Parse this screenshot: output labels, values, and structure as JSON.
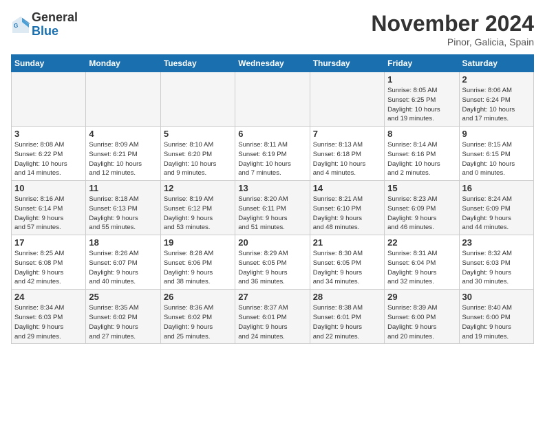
{
  "logo": {
    "line1": "General",
    "line2": "Blue"
  },
  "title": "November 2024",
  "location": "Pinor, Galicia, Spain",
  "days_of_week": [
    "Sunday",
    "Monday",
    "Tuesday",
    "Wednesday",
    "Thursday",
    "Friday",
    "Saturday"
  ],
  "weeks": [
    [
      {
        "day": "",
        "info": ""
      },
      {
        "day": "",
        "info": ""
      },
      {
        "day": "",
        "info": ""
      },
      {
        "day": "",
        "info": ""
      },
      {
        "day": "",
        "info": ""
      },
      {
        "day": "1",
        "info": "Sunrise: 8:05 AM\nSunset: 6:25 PM\nDaylight: 10 hours\nand 19 minutes."
      },
      {
        "day": "2",
        "info": "Sunrise: 8:06 AM\nSunset: 6:24 PM\nDaylight: 10 hours\nand 17 minutes."
      }
    ],
    [
      {
        "day": "3",
        "info": "Sunrise: 8:08 AM\nSunset: 6:22 PM\nDaylight: 10 hours\nand 14 minutes."
      },
      {
        "day": "4",
        "info": "Sunrise: 8:09 AM\nSunset: 6:21 PM\nDaylight: 10 hours\nand 12 minutes."
      },
      {
        "day": "5",
        "info": "Sunrise: 8:10 AM\nSunset: 6:20 PM\nDaylight: 10 hours\nand 9 minutes."
      },
      {
        "day": "6",
        "info": "Sunrise: 8:11 AM\nSunset: 6:19 PM\nDaylight: 10 hours\nand 7 minutes."
      },
      {
        "day": "7",
        "info": "Sunrise: 8:13 AM\nSunset: 6:18 PM\nDaylight: 10 hours\nand 4 minutes."
      },
      {
        "day": "8",
        "info": "Sunrise: 8:14 AM\nSunset: 6:16 PM\nDaylight: 10 hours\nand 2 minutes."
      },
      {
        "day": "9",
        "info": "Sunrise: 8:15 AM\nSunset: 6:15 PM\nDaylight: 10 hours\nand 0 minutes."
      }
    ],
    [
      {
        "day": "10",
        "info": "Sunrise: 8:16 AM\nSunset: 6:14 PM\nDaylight: 9 hours\nand 57 minutes."
      },
      {
        "day": "11",
        "info": "Sunrise: 8:18 AM\nSunset: 6:13 PM\nDaylight: 9 hours\nand 55 minutes."
      },
      {
        "day": "12",
        "info": "Sunrise: 8:19 AM\nSunset: 6:12 PM\nDaylight: 9 hours\nand 53 minutes."
      },
      {
        "day": "13",
        "info": "Sunrise: 8:20 AM\nSunset: 6:11 PM\nDaylight: 9 hours\nand 51 minutes."
      },
      {
        "day": "14",
        "info": "Sunrise: 8:21 AM\nSunset: 6:10 PM\nDaylight: 9 hours\nand 48 minutes."
      },
      {
        "day": "15",
        "info": "Sunrise: 8:23 AM\nSunset: 6:09 PM\nDaylight: 9 hours\nand 46 minutes."
      },
      {
        "day": "16",
        "info": "Sunrise: 8:24 AM\nSunset: 6:09 PM\nDaylight: 9 hours\nand 44 minutes."
      }
    ],
    [
      {
        "day": "17",
        "info": "Sunrise: 8:25 AM\nSunset: 6:08 PM\nDaylight: 9 hours\nand 42 minutes."
      },
      {
        "day": "18",
        "info": "Sunrise: 8:26 AM\nSunset: 6:07 PM\nDaylight: 9 hours\nand 40 minutes."
      },
      {
        "day": "19",
        "info": "Sunrise: 8:28 AM\nSunset: 6:06 PM\nDaylight: 9 hours\nand 38 minutes."
      },
      {
        "day": "20",
        "info": "Sunrise: 8:29 AM\nSunset: 6:05 PM\nDaylight: 9 hours\nand 36 minutes."
      },
      {
        "day": "21",
        "info": "Sunrise: 8:30 AM\nSunset: 6:05 PM\nDaylight: 9 hours\nand 34 minutes."
      },
      {
        "day": "22",
        "info": "Sunrise: 8:31 AM\nSunset: 6:04 PM\nDaylight: 9 hours\nand 32 minutes."
      },
      {
        "day": "23",
        "info": "Sunrise: 8:32 AM\nSunset: 6:03 PM\nDaylight: 9 hours\nand 30 minutes."
      }
    ],
    [
      {
        "day": "24",
        "info": "Sunrise: 8:34 AM\nSunset: 6:03 PM\nDaylight: 9 hours\nand 29 minutes."
      },
      {
        "day": "25",
        "info": "Sunrise: 8:35 AM\nSunset: 6:02 PM\nDaylight: 9 hours\nand 27 minutes."
      },
      {
        "day": "26",
        "info": "Sunrise: 8:36 AM\nSunset: 6:02 PM\nDaylight: 9 hours\nand 25 minutes."
      },
      {
        "day": "27",
        "info": "Sunrise: 8:37 AM\nSunset: 6:01 PM\nDaylight: 9 hours\nand 24 minutes."
      },
      {
        "day": "28",
        "info": "Sunrise: 8:38 AM\nSunset: 6:01 PM\nDaylight: 9 hours\nand 22 minutes."
      },
      {
        "day": "29",
        "info": "Sunrise: 8:39 AM\nSunset: 6:00 PM\nDaylight: 9 hours\nand 20 minutes."
      },
      {
        "day": "30",
        "info": "Sunrise: 8:40 AM\nSunset: 6:00 PM\nDaylight: 9 hours\nand 19 minutes."
      }
    ]
  ]
}
